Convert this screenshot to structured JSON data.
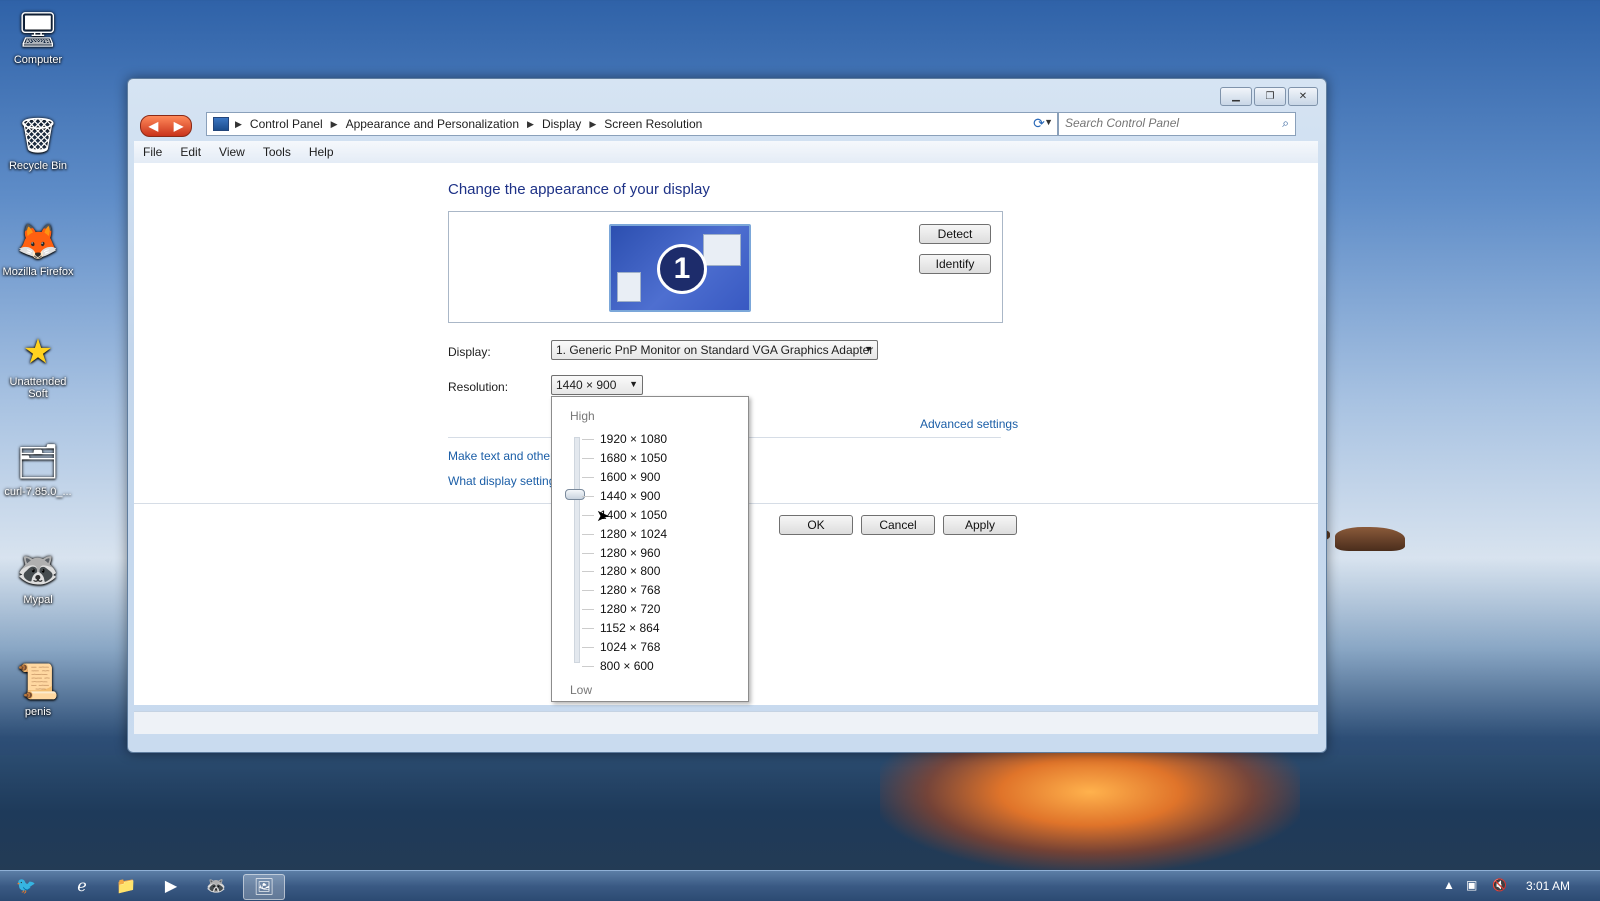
{
  "desktop": {
    "icons": [
      {
        "label": "Computer",
        "icon": "computer-icon"
      },
      {
        "label": "Recycle Bin",
        "icon": "recycle-bin-icon"
      },
      {
        "label": "Mozilla Firefox",
        "icon": "firefox-icon"
      },
      {
        "label": "Unattended Soft",
        "icon": "star-icon"
      },
      {
        "label": "curl-7.85.0_...",
        "icon": "zip-folder-icon"
      },
      {
        "label": "Mypal",
        "icon": "raccoon-icon"
      },
      {
        "label": "penis",
        "icon": "certificate-icon"
      }
    ]
  },
  "window": {
    "breadcrumb": [
      "Control Panel",
      "Appearance and Personalization",
      "Display",
      "Screen Resolution"
    ],
    "search_placeholder": "Search Control Panel",
    "menu": [
      "File",
      "Edit",
      "View",
      "Tools",
      "Help"
    ],
    "heading": "Change the appearance of your display",
    "monitor_number": "1",
    "detect_label": "Detect",
    "identify_label": "Identify",
    "display_label": "Display:",
    "display_value": "1. Generic PnP Monitor on Standard VGA Graphics Adapter",
    "resolution_label": "Resolution:",
    "resolution_value": "1440 × 900",
    "advanced_settings": "Advanced settings",
    "link_text_size": "Make text and other",
    "link_what_settings": "What display setting",
    "ok_label": "OK",
    "cancel_label": "Cancel",
    "apply_label": "Apply"
  },
  "resolution_dropdown": {
    "high_label": "High",
    "low_label": "Low",
    "options": [
      "1920 × 1080",
      "1680 × 1050",
      "1600 × 900",
      "1440 × 900",
      "1400 × 1050",
      "1280 × 1024",
      "1280 × 960",
      "1280 × 800",
      "1280 × 768",
      "1280 × 720",
      "1152 × 864",
      "1024 × 768",
      "800 × 600"
    ],
    "selected": "1440 × 900"
  },
  "taskbar": {
    "clock": "3:01 AM"
  }
}
